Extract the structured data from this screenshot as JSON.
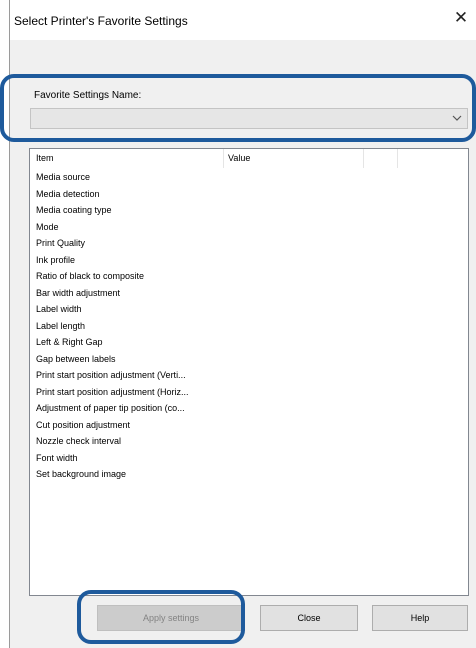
{
  "window": {
    "title": "Select Printer's Favorite Settings",
    "close_glyph": "✕"
  },
  "favorite": {
    "label": "Favorite Settings Name:",
    "value": ""
  },
  "list": {
    "columns": [
      "Item",
      "Value",
      "",
      ""
    ],
    "items": [
      "Media source",
      "Media detection",
      "Media coating type",
      "Mode",
      "Print Quality",
      "Ink profile",
      "Ratio of black to composite",
      "Bar width adjustment",
      "Label width",
      "Label length",
      "Left & Right Gap",
      "Gap between labels",
      "Print start position adjustment (Verti...",
      "Print start position adjustment (Horiz...",
      "Adjustment of paper tip position (co...",
      "Cut position adjustment",
      "Nozzle check interval",
      "Font width",
      "Set background image"
    ]
  },
  "buttons": {
    "apply": "Apply settings",
    "close": "Close",
    "help": "Help"
  },
  "colors": {
    "highlight": "#1e5a9c",
    "window_bg": "#f0f0f0"
  }
}
